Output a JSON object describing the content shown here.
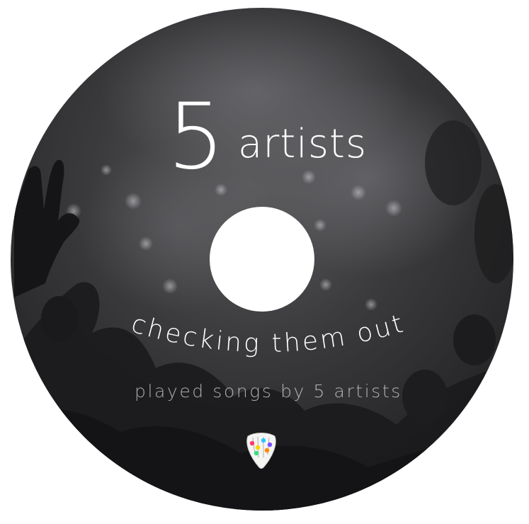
{
  "disc": {
    "count": "5",
    "count_word": "artists",
    "curved_title": "checking them out",
    "subtitle": "played songs by 5 artists",
    "logo_icon": "guitar-pick-logo-icon",
    "colors": {
      "disc_dark": "#2b2b2e",
      "disc_mid": "#4a4a4c",
      "text": "#ffffff",
      "logo_dots": [
        "#ff3b6b",
        "#ffd400",
        "#2ec5ff",
        "#7a4dff",
        "#38e07a",
        "#ff8a00"
      ]
    }
  }
}
